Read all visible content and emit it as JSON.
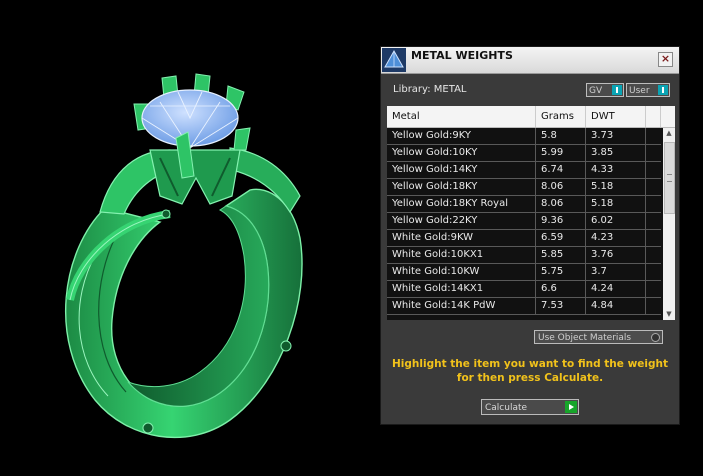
{
  "dialog": {
    "title": "METAL WEIGHTS",
    "close_glyph": "×",
    "library_label": "Library: METAL",
    "toggle_gv": "GV",
    "toggle_user": "User",
    "columns": [
      "Metal",
      "Grams",
      "DWT"
    ],
    "rows": [
      {
        "metal": "Yellow Gold:9KY",
        "grams": "5.8",
        "dwt": "3.73"
      },
      {
        "metal": "Yellow Gold:10KY",
        "grams": "5.99",
        "dwt": "3.85"
      },
      {
        "metal": "Yellow Gold:14KY",
        "grams": "6.74",
        "dwt": "4.33"
      },
      {
        "metal": "Yellow Gold:18KY",
        "grams": "8.06",
        "dwt": "5.18"
      },
      {
        "metal": "Yellow Gold:18KY Royal",
        "grams": "8.06",
        "dwt": "5.18"
      },
      {
        "metal": "Yellow Gold:22KY",
        "grams": "9.36",
        "dwt": "6.02"
      },
      {
        "metal": "White Gold:9KW",
        "grams": "6.59",
        "dwt": "4.23"
      },
      {
        "metal": "White Gold:10KX1",
        "grams": "5.85",
        "dwt": "3.76"
      },
      {
        "metal": "White Gold:10KW",
        "grams": "5.75",
        "dwt": "3.7"
      },
      {
        "metal": "White Gold:14KX1",
        "grams": "6.6",
        "dwt": "4.24"
      },
      {
        "metal": "White Gold:14K PdW",
        "grams": "7.53",
        "dwt": "4.84"
      }
    ],
    "use_object_materials": "Use Object Materials",
    "hint": "Highlight the item you want to find the weight for then press Calculate.",
    "calculate_label": "Calculate",
    "icons": {
      "title": "pyramid-icon",
      "close": "close-icon",
      "calculate": "play-arrow-icon"
    },
    "colors": {
      "accent": "#0aa4b4",
      "hint_text": "#f1c21b",
      "calc_button": "#17a52a",
      "ring_green": "#2fcf6b",
      "gem_blue": "#8fb8f0"
    }
  }
}
